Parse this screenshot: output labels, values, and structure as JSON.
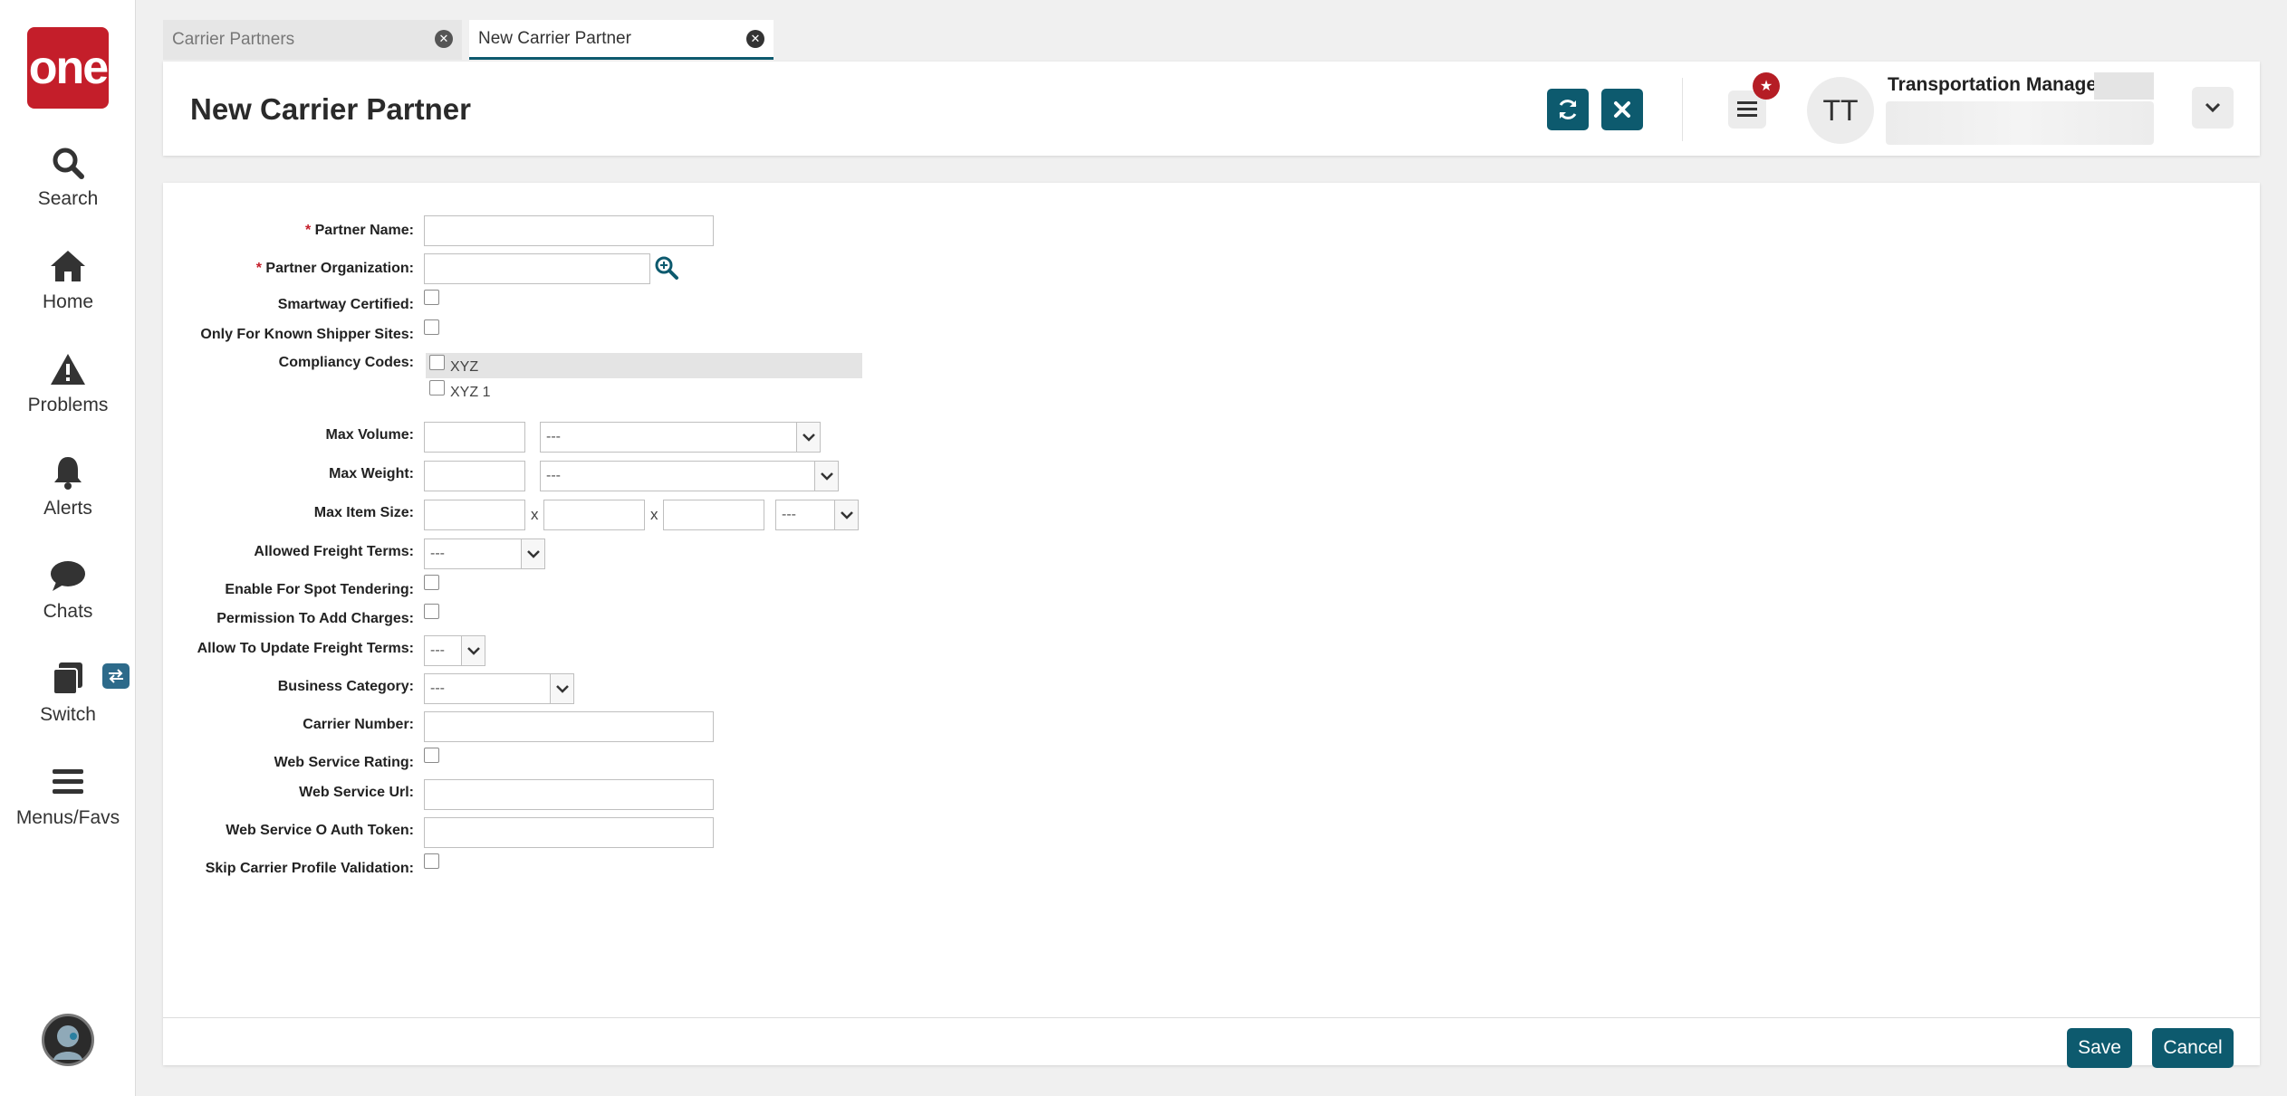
{
  "logo": {
    "text": "one",
    "color": "#c41e2a"
  },
  "nav": {
    "items": [
      {
        "label": "Search",
        "icon": "search-icon"
      },
      {
        "label": "Home",
        "icon": "home-icon"
      },
      {
        "label": "Problems",
        "icon": "warning-icon"
      },
      {
        "label": "Alerts",
        "icon": "bell-icon"
      },
      {
        "label": "Chats",
        "icon": "chat-bubble-icon"
      },
      {
        "label": "Switch",
        "icon": "switch-icon"
      },
      {
        "label": "Menus/Favs",
        "icon": "hamburger-icon"
      }
    ]
  },
  "tabs": [
    {
      "label": "Carrier Partners",
      "active": false
    },
    {
      "label": "New Carrier Partner",
      "active": true
    }
  ],
  "header": {
    "title": "New Carrier Partner",
    "user_initials": "TT",
    "user_role": "Transportation Manager",
    "accent_color": "#0d5a6e",
    "badge_color": "#b51d25"
  },
  "form": {
    "partner_name_label": "Partner Name:",
    "partner_org_label": "Partner Organization:",
    "smartway_label": "Smartway Certified:",
    "known_shipper_label": "Only For Known Shipper Sites:",
    "compliancy_label": "Compliancy Codes:",
    "compliancy_codes": [
      "XYZ",
      "XYZ 1"
    ],
    "max_volume_label": "Max Volume:",
    "max_volume_unit": "---",
    "max_weight_label": "Max Weight:",
    "max_weight_unit": "---",
    "max_item_size_label": "Max Item Size:",
    "size_separator": "x",
    "max_item_size_unit": "---",
    "freight_terms_label": "Allowed Freight Terms:",
    "freight_terms_value": "---",
    "spot_tendering_label": "Enable For Spot Tendering:",
    "add_charges_label": "Permission To Add Charges:",
    "update_freight_label": "Allow To Update Freight Terms:",
    "update_freight_value": "---",
    "business_category_label": "Business Category:",
    "business_category_value": "---",
    "carrier_number_label": "Carrier Number:",
    "ws_rating_label": "Web Service Rating:",
    "ws_url_label": "Web Service Url:",
    "ws_token_label": "Web Service O Auth Token:",
    "skip_validation_label": "Skip Carrier Profile Validation:",
    "required_mark": "*"
  },
  "footer": {
    "save_label": "Save",
    "cancel_label": "Cancel"
  }
}
